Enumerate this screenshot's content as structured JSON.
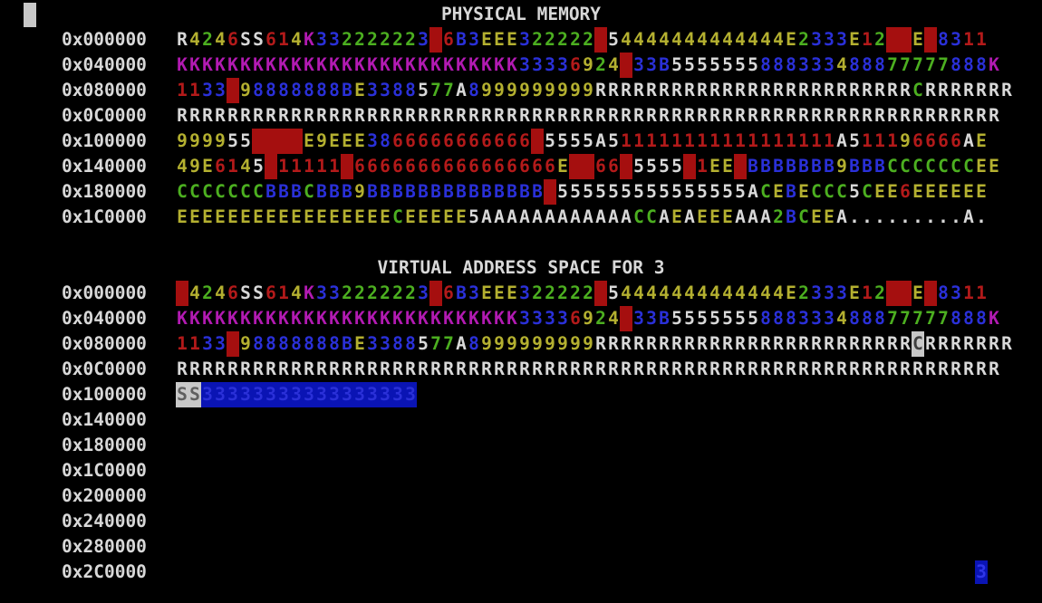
{
  "colors": {
    "background": "#000000",
    "text": "#d8d8d8",
    "red": "#b31a1a",
    "green": "#4caf20",
    "yellow": "#b4b030",
    "blue": "#2a30d8",
    "magenta": "#b21ab2",
    "white": "#d8d8d8",
    "highlight_red": "#a50f0f",
    "highlight_blue": "#0a14b4",
    "highlight_white": "#c8c8c8"
  },
  "legend": {
    "codes": "Cell code: 1st char = fg (r red, g green, y yellow, b blue, m magenta, w white, k black), 2nd char = bg (_ none, R red, B blue, W white)"
  },
  "physical": {
    "title": "PHYSICAL MEMORY",
    "rows": [
      {
        "addr": "0x000000",
        "text": "R4246SS614K332222223 6B3EEE322222 54444444444444E2333E12  E 8311",
        "codes": "wwyyrwwrryr"
      },
      {
        "addr": "0x040000",
        "text": "KKKKKKKKKKKKKKKKKKKKKKKKKKK33336924 33B5555555888333488877777888K"
      },
      {
        "addr": "0x080000",
        "text": "1133 98888888BE3388577A8999999999RRRRRRRRRRRRRRRRRRRRRRRRRCRRRRRRR"
      },
      {
        "addr": "0x0C0000",
        "text": "RRRRRRRRRRRRRRRRRRRRRRRRRRRRRRRRRRRRRRRRRRRRRRRRRRRRRRRRRRRRRRRRR"
      },
      {
        "addr": "0x100000",
        "text": "999955    E9EEE3866666666666 5555A511111111111111111A511196666AE"
      },
      {
        "addr": "0x140000",
        "text": "49E6145 11111 6666666666666666E  66 5555 1EE BBBBBBB9BBBCCCCCCCEE"
      },
      {
        "addr": "0x180000",
        "text": "CCCCCCCBBBCBBB9BBBBBBBBBBBBBB 555555555555555ACEBECCC5CEE6EEEEEE"
      },
      {
        "addr": "0x1C0000",
        "text": "EEEEEEEEEEEEEEEEECEEEEE5AAAAAAAAAAAACCAEAEEEAAA2BCEEA.........A."
      }
    ]
  },
  "virtual": {
    "title": "VIRTUAL ADDRESS SPACE FOR 3",
    "rows": [
      {
        "addr": "0x000000"
      },
      {
        "addr": "0x040000"
      },
      {
        "addr": "0x080000"
      },
      {
        "addr": "0x0C0000"
      },
      {
        "addr": "0x100000",
        "text": "SS33333333333333333"
      },
      {
        "addr": "0x140000",
        "text": ""
      },
      {
        "addr": "0x180000",
        "text": ""
      },
      {
        "addr": "0x1C0000",
        "text": ""
      },
      {
        "addr": "0x200000",
        "text": ""
      },
      {
        "addr": "0x240000",
        "text": ""
      },
      {
        "addr": "0x280000",
        "text": ""
      },
      {
        "addr": "0x2C0000",
        "text": ""
      }
    ]
  },
  "corner_marker": "3"
}
